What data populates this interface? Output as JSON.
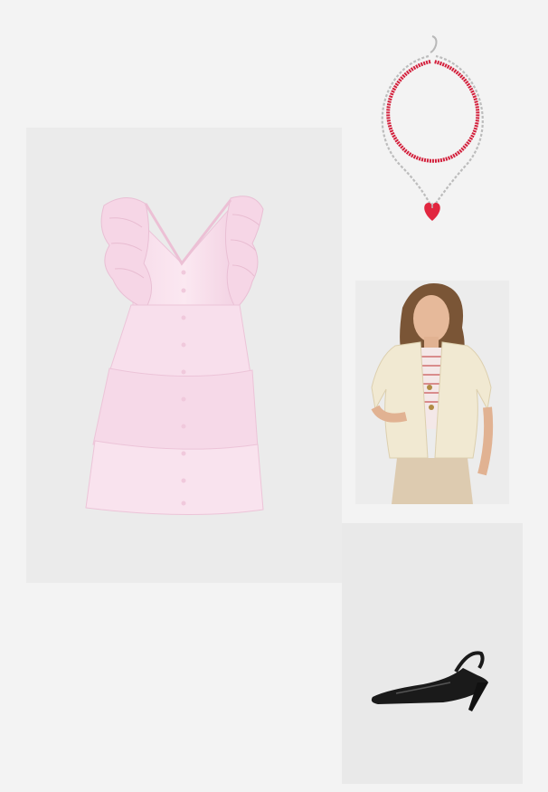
{
  "board": {
    "background": "#f3f3f3",
    "items": [
      {
        "id": "dress",
        "icon": "ruffled-pink-dress-image",
        "accent": "#f3cfe2"
      },
      {
        "id": "necklace",
        "icon": "layered-necklace-image",
        "accent": "#d3203c"
      },
      {
        "id": "jacket",
        "icon": "model-cream-jacket-image",
        "accent": "#f1e9d2"
      },
      {
        "id": "shoe",
        "icon": "black-slingback-pump-image",
        "accent": "#1a1a1a"
      }
    ]
  }
}
